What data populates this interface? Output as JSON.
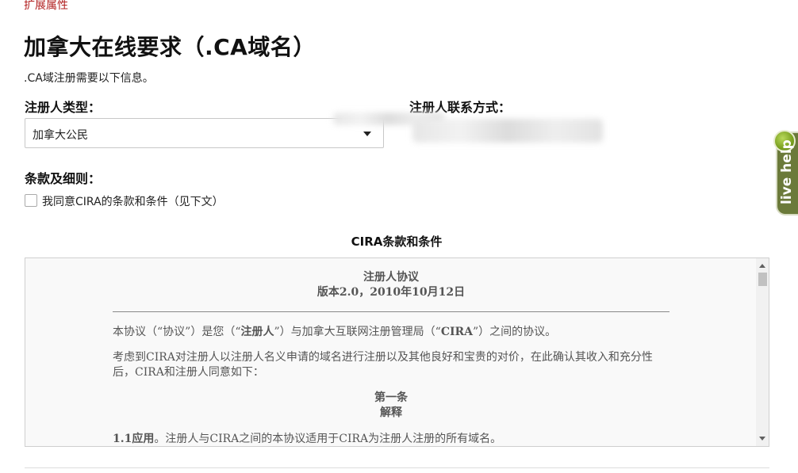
{
  "top_link": "扩展属性",
  "page_title": "加拿大在线要求（.CA域名）",
  "subtitle": ".CA域注册需要以下信息。",
  "registrant_type": {
    "label": "注册人类型：",
    "selected": "加拿大公民"
  },
  "registrant_contact": {
    "label": "注册人联系方式："
  },
  "terms": {
    "label": "条款及细则：",
    "agree_label": "我同意CIRA的条款和条件（见下文）",
    "box_title": "CIRA条款和条件",
    "doc_title": "注册人协议",
    "doc_version": "版本2.0，2010年10月12日",
    "para1_a": "本协议（“协议”）是您（“",
    "para1_b": "注册人",
    "para1_c": "”）与加拿大互联网注册管理局（“",
    "para1_d": "CIRA",
    "para1_e": "”）之间的协议。",
    "para2": "考虑到CIRA对注册人以注册人名义申请的域名进行注册以及其他良好和宝贵的对价，在此确认其收入和充分性后，CIRA和注册人同意如下：",
    "section_num": "第一条",
    "section_title": "解释",
    "clause_num": "1.1应用",
    "clause_text": "。注册人与CIRA之间的本协议适用于CIRA为注册人注册的所有域名。"
  },
  "live_help": "live help"
}
